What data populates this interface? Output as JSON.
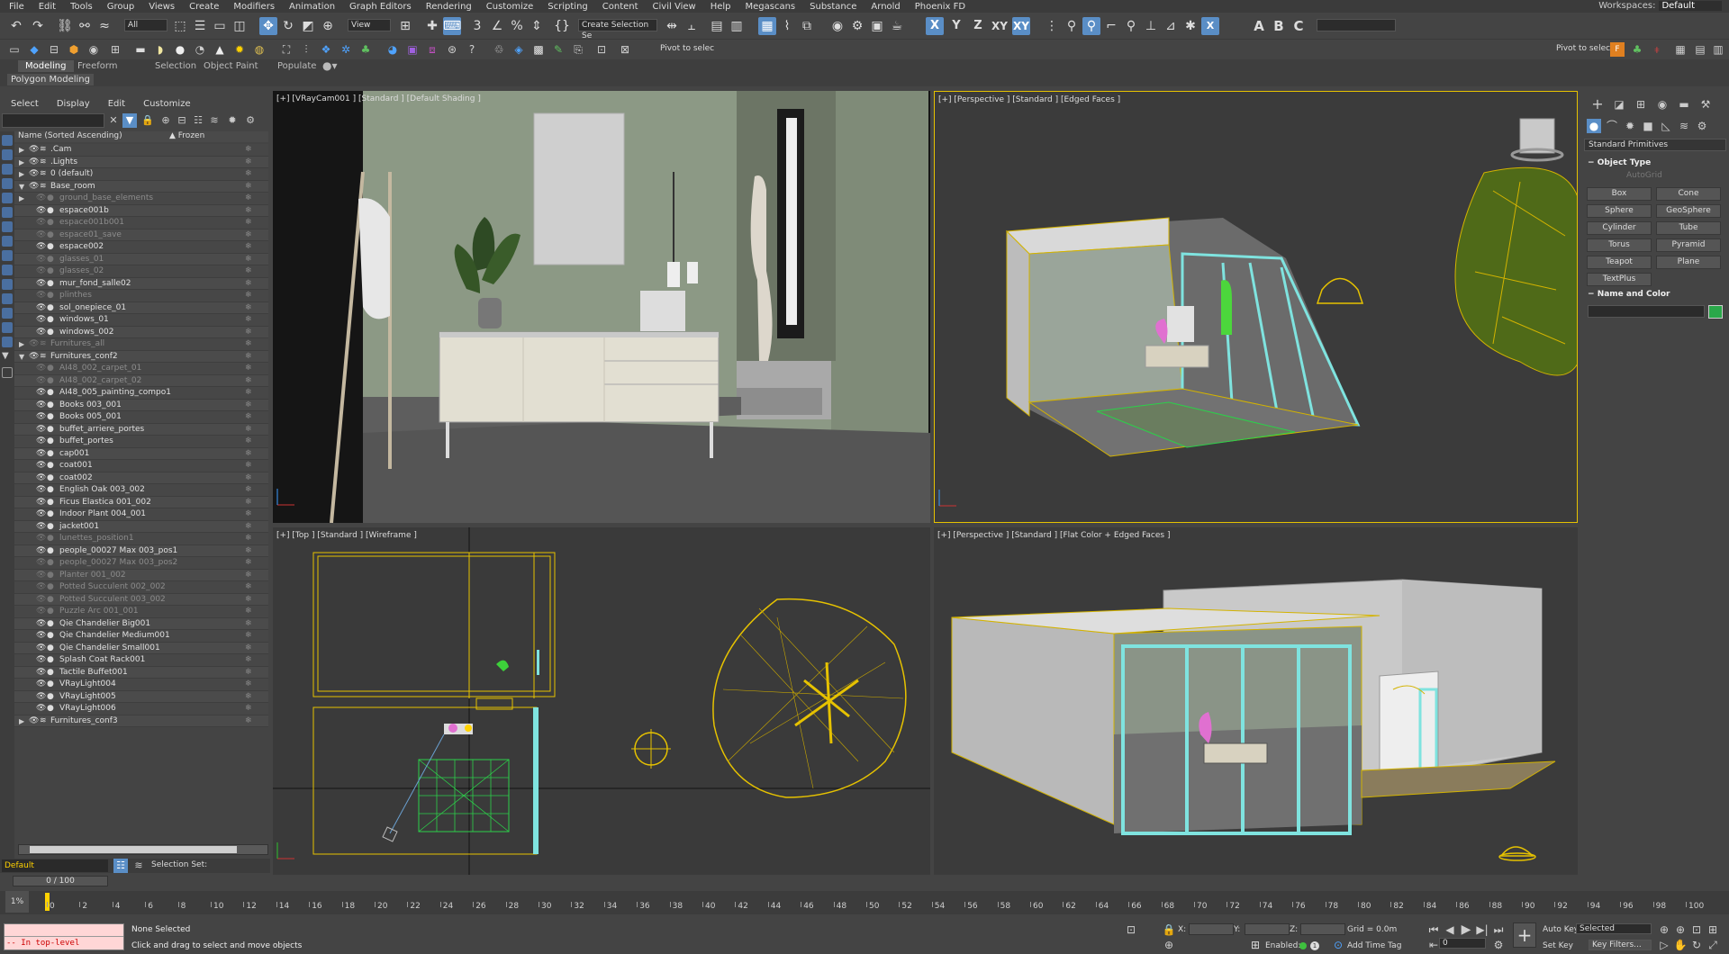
{
  "menu": [
    "File",
    "Edit",
    "Tools",
    "Group",
    "Views",
    "Create",
    "Modifiers",
    "Animation",
    "Graph Editors",
    "Rendering",
    "Customize",
    "Scripting",
    "Content",
    "Civil View",
    "Help",
    "Megascans",
    "Substance",
    "Arnold",
    "Phoenix FD"
  ],
  "workspace": {
    "label": "Workspaces:",
    "value": "Default"
  },
  "toolbar": {
    "filter_value": "All",
    "refcoord_value": "View",
    "selection_set_value": "Create Selection Se",
    "axis_x": "X",
    "axis_y": "Y",
    "axis_z": "Z",
    "axis_xy": "XY",
    "axis_xy2": "XY",
    "letter_a": "A",
    "letter_b": "B",
    "letter_c": "C",
    "pivot_text": "Pivot to selec",
    "pivot_text_right": "Pivot to selec"
  },
  "ribbon": {
    "tabs": [
      "Modeling",
      "Freeform",
      "Selection",
      "Object Paint",
      "Populate"
    ],
    "active": "Modeling",
    "sub": "Polygon Modeling"
  },
  "scene_explorer": {
    "menu": [
      "Select",
      "Display",
      "Edit",
      "Customize"
    ],
    "col_name": "Name (Sorted Ascending)",
    "col_frozen": "▲ Frozen",
    "rows": [
      {
        "name": ".Cam",
        "level": 0,
        "tri": "▶",
        "dim": false
      },
      {
        "name": ".Lights",
        "level": 0,
        "tri": "▶",
        "dim": false
      },
      {
        "name": "0 (default)",
        "level": 0,
        "tri": "▶",
        "dim": false
      },
      {
        "name": "Base_room",
        "level": 0,
        "tri": "▼",
        "dim": false
      },
      {
        "name": "ground_base_elements",
        "level": 1,
        "tri": "▶",
        "dim": true
      },
      {
        "name": "espace001b",
        "level": 1,
        "tri": "",
        "dim": false
      },
      {
        "name": "espace001b001",
        "level": 1,
        "tri": "",
        "dim": true
      },
      {
        "name": "espace01_save",
        "level": 1,
        "tri": "",
        "dim": true
      },
      {
        "name": "espace002",
        "level": 1,
        "tri": "",
        "dim": false
      },
      {
        "name": "glasses_01",
        "level": 1,
        "tri": "",
        "dim": true
      },
      {
        "name": "glasses_02",
        "level": 1,
        "tri": "",
        "dim": true
      },
      {
        "name": "mur_fond_salle02",
        "level": 1,
        "tri": "",
        "dim": false
      },
      {
        "name": "plinthes",
        "level": 1,
        "tri": "",
        "dim": true
      },
      {
        "name": "sol_onepiece_01",
        "level": 1,
        "tri": "",
        "dim": false
      },
      {
        "name": "windows_01",
        "level": 1,
        "tri": "",
        "dim": false
      },
      {
        "name": "windows_002",
        "level": 1,
        "tri": "",
        "dim": false
      },
      {
        "name": "Furnitures_all",
        "level": 0,
        "tri": "▶",
        "dim": true
      },
      {
        "name": "Furnitures_conf2",
        "level": 0,
        "tri": "▼",
        "dim": false
      },
      {
        "name": "AI48_002_carpet_01",
        "level": 1,
        "tri": "",
        "dim": true
      },
      {
        "name": "AI48_002_carpet_02",
        "level": 1,
        "tri": "",
        "dim": true
      },
      {
        "name": "AI48_005_painting_compo1",
        "level": 1,
        "tri": "",
        "dim": false
      },
      {
        "name": "Books 003_001",
        "level": 1,
        "tri": "",
        "dim": false
      },
      {
        "name": "Books 005_001",
        "level": 1,
        "tri": "",
        "dim": false
      },
      {
        "name": "buffet_arriere_portes",
        "level": 1,
        "tri": "",
        "dim": false
      },
      {
        "name": "buffet_portes",
        "level": 1,
        "tri": "",
        "dim": false
      },
      {
        "name": "cap001",
        "level": 1,
        "tri": "",
        "dim": false
      },
      {
        "name": "coat001",
        "level": 1,
        "tri": "",
        "dim": false
      },
      {
        "name": "coat002",
        "level": 1,
        "tri": "",
        "dim": false
      },
      {
        "name": "English Oak 003_002",
        "level": 1,
        "tri": "",
        "dim": false
      },
      {
        "name": "Ficus Elastica 001_002",
        "level": 1,
        "tri": "",
        "dim": false
      },
      {
        "name": "Indoor Plant 004_001",
        "level": 1,
        "tri": "",
        "dim": false
      },
      {
        "name": "jacket001",
        "level": 1,
        "tri": "",
        "dim": false
      },
      {
        "name": "lunettes_position1",
        "level": 1,
        "tri": "",
        "dim": true
      },
      {
        "name": "people_00027 Max 003_pos1",
        "level": 1,
        "tri": "",
        "dim": false
      },
      {
        "name": "people_00027 Max 003_pos2",
        "level": 1,
        "tri": "",
        "dim": true
      },
      {
        "name": "Planter 001_002",
        "level": 1,
        "tri": "",
        "dim": true
      },
      {
        "name": "Potted Succulent 002_002",
        "level": 1,
        "tri": "",
        "dim": true
      },
      {
        "name": "Potted Succulent 003_002",
        "level": 1,
        "tri": "",
        "dim": true
      },
      {
        "name": "Puzzle Arc 001_001",
        "level": 1,
        "tri": "",
        "dim": true
      },
      {
        "name": "Qie Chandelier Big001",
        "level": 1,
        "tri": "",
        "dim": false
      },
      {
        "name": "Qie Chandelier Medium001",
        "level": 1,
        "tri": "",
        "dim": false
      },
      {
        "name": "Qie Chandelier Small001",
        "level": 1,
        "tri": "",
        "dim": false
      },
      {
        "name": "Splash Coat Rack001",
        "level": 1,
        "tri": "",
        "dim": false
      },
      {
        "name": "Tactile Buffet001",
        "level": 1,
        "tri": "",
        "dim": false
      },
      {
        "name": "VRayLight004",
        "level": 1,
        "tri": "",
        "dim": false
      },
      {
        "name": "VRayLight005",
        "level": 1,
        "tri": "",
        "dim": false
      },
      {
        "name": "VRayLight006",
        "level": 1,
        "tri": "",
        "dim": false
      },
      {
        "name": "Furnitures_conf3",
        "level": 0,
        "tri": "▶",
        "dim": false
      }
    ],
    "layer_value": "Default",
    "selection_set_label": "Selection Set:"
  },
  "viewports": {
    "vp1_label": "[+] [VRayCam001 ] [Standard ] [Default Shading ]",
    "vp2_label": "[+] [Perspective ] [Standard ] [Edged Faces ]",
    "vp3_label": "[+] [Top ] [Standard ] [Wireframe ]",
    "vp4_label": "[+] [Perspective ] [Standard ] [Flat Color + Edged Faces ]"
  },
  "command_panel": {
    "category": "Standard Primitives",
    "object_type_title": "Object Type",
    "autogrid": "AutoGrid",
    "buttons": [
      "Box",
      "Cone",
      "Sphere",
      "GeoSphere",
      "Cylinder",
      "Tube",
      "Torus",
      "Pyramid",
      "Teapot",
      "Plane",
      "TextPlus"
    ],
    "name_color_title": "Name and Color",
    "swatch_color": "#2aa84a"
  },
  "timeline": {
    "frame_display": "0 / 100",
    "tick_labels": [
      "0",
      "2",
      "4",
      "6",
      "8",
      "10",
      "12",
      "14",
      "16",
      "18",
      "20",
      "22",
      "24",
      "26",
      "28",
      "30",
      "32",
      "34",
      "36",
      "38",
      "40",
      "42",
      "44",
      "46",
      "48",
      "50",
      "52",
      "54",
      "56",
      "58",
      "60",
      "62",
      "64",
      "66",
      "68",
      "70",
      "72",
      "74",
      "76",
      "78",
      "80",
      "82",
      "84",
      "86",
      "88",
      "90",
      "92",
      "94",
      "96",
      "98",
      "100"
    ]
  },
  "status": {
    "maxscript_line1": "",
    "maxscript_line2": "-- In top-level",
    "selection": "None Selected",
    "prompt": "Click and drag to select and move objects",
    "x_label": "X:",
    "y_label": "Y:",
    "z_label": "Z:",
    "grid": "Grid = 0.0m",
    "enabled": "Enabled:",
    "add_time_tag": "Add Time Tag",
    "auto_key": "Auto Key",
    "set_key": "Set Key",
    "selected": "Selected",
    "key_filters": "Key Filters...",
    "frame_value": "0"
  }
}
